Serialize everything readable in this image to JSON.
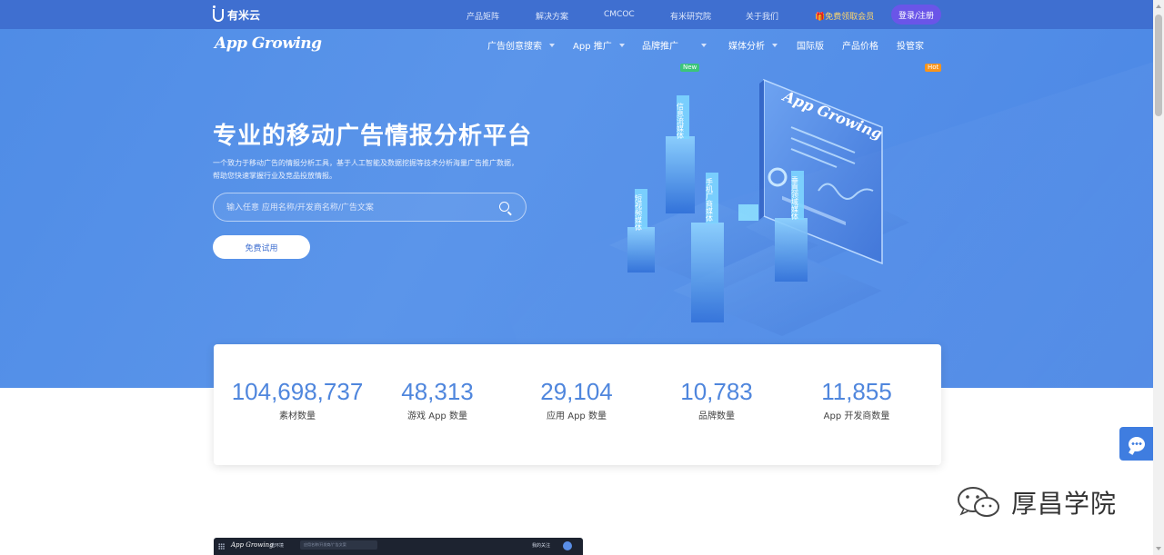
{
  "topbar": {
    "logo_text": "有米云",
    "links": [
      "产品矩阵",
      "解决方案",
      "CMCOC",
      "有米研究院",
      "关于我们"
    ],
    "vip_label": "免费领取会员",
    "login_label": "登录/注册"
  },
  "nav": {
    "brand": "App Growing",
    "items": [
      {
        "label": "广告创意搜索",
        "has_caret": true
      },
      {
        "label": "App 推广",
        "has_caret": true
      },
      {
        "label": "品牌推广",
        "has_caret": true,
        "badge": "New"
      },
      {
        "label": "媒体分析",
        "has_caret": true
      },
      {
        "label": "国际版",
        "has_caret": false
      },
      {
        "label": "产品价格",
        "has_caret": false
      },
      {
        "label": "投管家",
        "has_caret": false,
        "badge": "Hot"
      }
    ]
  },
  "hero": {
    "title": "专业的移动广告情报分析平台",
    "description": "一个致力于移动广告的情报分析工具，基于人工智能及数据挖掘等技术分析海量广告推广数据，帮助您快速掌握行业及竞品投放情报。",
    "search_placeholder": "输入任意 应用名称/开发商名称/广告文案",
    "cta_label": "免费试用",
    "illustration": {
      "board_brand": "App Growing",
      "pillar_labels": [
        "信息流媒体",
        "短视频媒体",
        "手机厂商媒体",
        "垂直领域媒体"
      ]
    }
  },
  "stats": [
    {
      "value": "104,698,737",
      "label": "素材数量"
    },
    {
      "value": "48,313",
      "label": "游戏 App 数量"
    },
    {
      "value": "29,104",
      "label": "应用 App 数量"
    },
    {
      "value": "10,783",
      "label": "品牌数量"
    },
    {
      "value": "11,855",
      "label": "App 开发商数量"
    }
  ],
  "watermark": {
    "text": "厚昌学院"
  },
  "preview_strip": {
    "brand": "App Growing",
    "region": "选环境",
    "search_placeholder": "应用名称/开发商/广告文案",
    "account": "我的关注"
  },
  "colors": {
    "topbar": "#3f6fd0",
    "hero": "#5b95ea",
    "accent_number": "#4f86dd",
    "login_button": "#6a55e8",
    "badge_new": "#3bc57a",
    "badge_hot": "#f7941d"
  }
}
